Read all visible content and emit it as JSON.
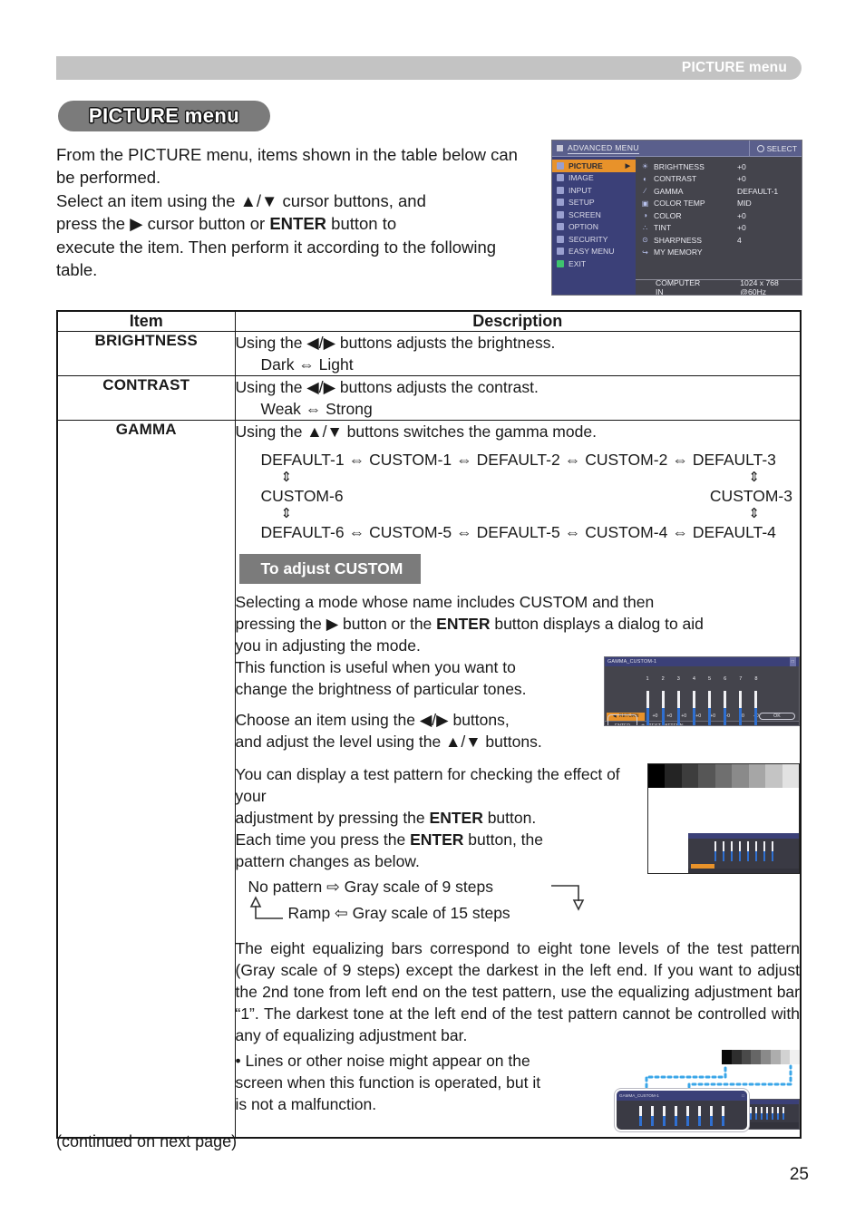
{
  "header": {
    "running_title": "PICTURE menu"
  },
  "page": {
    "title": "PICTURE menu",
    "intro_line1": "From the PICTURE menu, items shown in the table",
    "intro_line2": "below can be performed.",
    "intro_line3_a": "Select an item using the ▲/▼ cursor buttons, and",
    "intro_line4_a": "press the ▶ cursor button or ",
    "intro_line4_b": "ENTER",
    "intro_line4_c": " button to",
    "intro_line5": "execute the item. Then perform it according to the",
    "intro_line6": "following table.",
    "continued": "(continued on next page)",
    "page_number": "25"
  },
  "osd_advanced": {
    "title": "ADVANCED MENU",
    "select_label": "SELECT",
    "left_items": [
      {
        "label": "PICTURE",
        "active": true
      },
      {
        "label": "IMAGE",
        "active": false
      },
      {
        "label": "INPUT",
        "active": false
      },
      {
        "label": "SETUP",
        "active": false
      },
      {
        "label": "SCREEN",
        "active": false
      },
      {
        "label": "OPTION",
        "active": false
      },
      {
        "label": "SECURITY",
        "active": false
      },
      {
        "label": "EASY MENU",
        "active": false
      },
      {
        "label": "EXIT",
        "active": false
      }
    ],
    "right_items": [
      {
        "icon": "☀",
        "name": "BRIGHTNESS",
        "value": "+0"
      },
      {
        "icon": "◐",
        "name": "CONTRAST",
        "value": "+0"
      },
      {
        "icon": "∕",
        "name": "GAMMA",
        "value": "DEFAULT-1"
      },
      {
        "icon": "▣",
        "name": "COLOR TEMP",
        "value": "MID"
      },
      {
        "icon": "◑",
        "name": "COLOR",
        "value": "+0"
      },
      {
        "icon": "∴",
        "name": "TINT",
        "value": "+0"
      },
      {
        "icon": "⊙",
        "name": "SHARPNESS",
        "value": "4"
      },
      {
        "icon": "↪",
        "name": "MY MEMORY",
        "value": ""
      }
    ],
    "footer_source": "COMPUTER IN",
    "footer_signal": "1024 x 768 @60Hz"
  },
  "table": {
    "head": {
      "item": "Item",
      "description": "Description"
    },
    "brightness": {
      "item": "BRIGHTNESS",
      "line1": "Using the ◀/▶ buttons adjusts the brightness.",
      "line2": "Dark ⇔ Light"
    },
    "contrast": {
      "item": "CONTRAST",
      "line1": "Using the ◀/▶ buttons adjusts the contrast.",
      "line2": "Weak ⇔ Strong"
    },
    "gamma": {
      "item": "GAMMA",
      "intro": "Using the ▲/▼ buttons switches the gamma mode.",
      "cycle": {
        "top_row": [
          "DEFAULT-1",
          "CUSTOM-1",
          "DEFAULT-2",
          "CUSTOM-2",
          "DEFAULT-3"
        ],
        "mid_left": "CUSTOM-6",
        "mid_right": "CUSTOM-3",
        "bottom_row": [
          "DEFAULT-6",
          "CUSTOM-5",
          "DEFAULT-5",
          "CUSTOM-4",
          "DEFAULT-4"
        ],
        "h_arrow": "⇔",
        "v_arrow": "⇕"
      },
      "adjust_banner": "To adjust CUSTOM",
      "p1_a": "Selecting a mode whose name includes CUSTOM and then",
      "p1_b": "pressing the ▶ button or the ",
      "p1_bold": "ENTER",
      "p1_c": " button displays a dialog to aid",
      "p1_d": "you in adjusting the mode.",
      "p2_l1": "This function is useful when you want to",
      "p2_l2": "change the brightness of particular tones.",
      "p3_l1": "Choose an item using the ◀/▶ buttons,",
      "p3_l2": "and  adjust the level using the ▲/▼ buttons.",
      "p4_l1_a": "You can display a test pattern for checking the effect of your",
      "p4_l2_a": "adjustment by pressing the ",
      "p4_bold1": "ENTER",
      "p4_l2_b": " button.",
      "p4_l3_a": "Each time you press the ",
      "p4_bold2": "ENTER",
      "p4_l3_b": " button, the",
      "p4_l4": "pattern changes as below.",
      "cycle2_line1": "No pattern ⇨ Gray scale of 9 steps",
      "cycle2_line2": "Ramp ⇦ Gray scale of 15 steps",
      "p5": "The eight equalizing bars correspond to eight tone levels of the test pattern (Gray scale of 9 steps) except the darkest in the left end. If you want to adjust the 2nd tone from left end on the test pattern, use the equalizing adjustment bar “1”. The darkest tone at the left end of the test pattern cannot be controlled with any of equalizing adjustment bar.",
      "p6_l1": "• Lines or other noise might appear on the",
      "p6_l2": "screen when this function is operated, but it",
      "p6_l3": "is not a malfunction."
    }
  },
  "gamma_dialog": {
    "title": "GAMMA_CUSTOM-1",
    "bar_numbers": [
      "1",
      "2",
      "3",
      "4",
      "5",
      "6",
      "7",
      "8"
    ],
    "bar_values": [
      "+0",
      "+0",
      "+0",
      "+0",
      "+0",
      "+0",
      "+0",
      "+0"
    ],
    "return_label": "RETURN",
    "ok_label": "OK",
    "enter_label": "ENTER",
    "test_pattern_label": "TEST PATTERN"
  },
  "colors": {
    "accent_orange": "#e8922a",
    "osd_blue": "#3b4078",
    "osd_titlebar": "#5a5f8c",
    "bar_blue": "#2f6fd0",
    "header_gray": "#c3c3c3",
    "pill_gray": "#7b7b7b",
    "dotted_blue": "#3aa6e8"
  }
}
